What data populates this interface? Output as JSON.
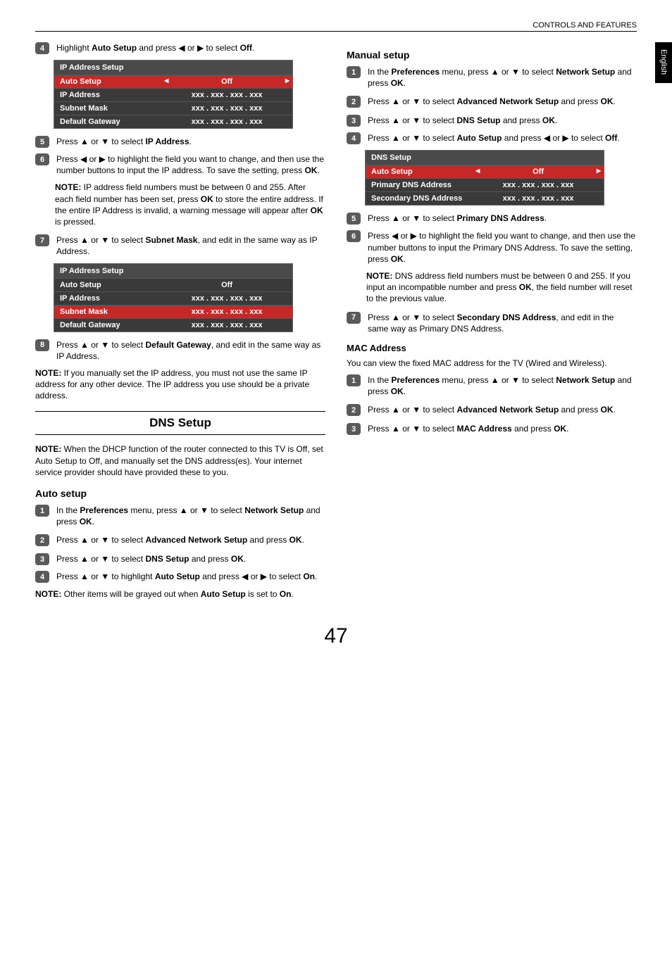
{
  "header": "CONTROLS AND FEATURES",
  "langTab": "English",
  "pageNumber": "47",
  "left": {
    "step4": {
      "pre": "Highlight ",
      "bold1": "Auto Setup",
      "mid": " and press ◀ or ▶ to select ",
      "bold2": "Off",
      "post": "."
    },
    "table1": {
      "title": "IP Address Setup",
      "rows": [
        {
          "label": "Auto Setup",
          "val": "Off",
          "sel": true,
          "arrows": true
        },
        {
          "label": "IP Address",
          "val": "xxx   .   xxx   .   xxx   .   xxx"
        },
        {
          "label": "Subnet Mask",
          "val": "xxx   .   xxx   .   xxx   .   xxx"
        },
        {
          "label": "Default Gateway",
          "val": "xxx   .   xxx   .   xxx   .   xxx"
        }
      ]
    },
    "step5": {
      "pre": "Press ▲ or ▼ to select ",
      "bold": "IP Address",
      "post": "."
    },
    "step6": {
      "pre": "Press ◀ or ▶ to highlight the field you want to change, and then use the number buttons to input the IP address. To save the setting, press ",
      "bold": "OK",
      "post": "."
    },
    "note1": {
      "label": "NOTE: ",
      "pre": "IP address field numbers must be between 0 and 255. After each field number has been set, press ",
      "b1": "OK",
      "mid": " to store the entire address. If the entire IP Address is invalid, a warning message will appear after ",
      "b2": "OK",
      "post": " is pressed."
    },
    "step7": {
      "pre": "Press ▲ or ▼ to select ",
      "bold": "Subnet Mask",
      "post": ", and edit in the same way as IP Address."
    },
    "table2": {
      "title": "IP Address Setup",
      "rows": [
        {
          "label": "Auto Setup",
          "val": "Off"
        },
        {
          "label": "IP Address",
          "val": "xxx   .   xxx   .   xxx   .   xxx"
        },
        {
          "label": "Subnet Mask",
          "val": "xxx   .   xxx   .   xxx   .   xxx",
          "sel": true
        },
        {
          "label": "Default Gateway",
          "val": "xxx   .   xxx   .   xxx   .   xxx"
        }
      ]
    },
    "step8": {
      "pre": "Press ▲ or ▼ to select ",
      "bold": "Default Gateway",
      "post": ", and edit in the same way as IP Address."
    },
    "note2": {
      "label": "NOTE: ",
      "text": "If you manually set the IP address, you must not use the same IP address for any other device. The IP address you use should be a private address."
    },
    "sectionTitle": "DNS Setup",
    "note3": {
      "label": "NOTE: ",
      "text": "When the DHCP function of the router connected to this TV is Off, set Auto Setup to Off, and manually set the DNS address(es). Your internet service provider should have provided these to you."
    },
    "autoSetupHeading": "Auto setup",
    "as_step1": {
      "pre": "In the ",
      "b1": "Preferences",
      "mid": " menu, press ▲ or ▼ to select ",
      "b2": "Network Setup",
      "mid2": " and press ",
      "b3": "OK",
      "post": "."
    },
    "as_step2": {
      "pre": "Press ▲ or ▼ to select ",
      "b1": "Advanced Network Setup",
      "mid": " and press ",
      "b2": "OK",
      "post": "."
    },
    "as_step3": {
      "pre": "Press ▲ or ▼ to select ",
      "b1": "DNS Setup",
      "mid": " and press ",
      "b2": "OK",
      "post": "."
    },
    "as_step4": {
      "pre": "Press ▲ or ▼ to highlight ",
      "b1": "Auto Setup",
      "mid": " and press ◀ or ▶ to select ",
      "b2": "On",
      "post": "."
    },
    "note4": {
      "label": "NOTE: ",
      "pre": "Other items will be grayed out when ",
      "b1": "Auto Setup",
      "mid": " is set to ",
      "b2": "On",
      "post": "."
    }
  },
  "right": {
    "manualHeading": "Manual setup",
    "ms_step1": {
      "pre": "In the ",
      "b1": "Preferences",
      "mid": " menu, press ▲ or ▼ to select ",
      "b2": "Network Setup",
      "mid2": " and press ",
      "b3": "OK",
      "post": "."
    },
    "ms_step2": {
      "pre": "Press ▲ or ▼ to select ",
      "b1": "Advanced Network Setup",
      "mid": " and press ",
      "b2": "OK",
      "post": "."
    },
    "ms_step3": {
      "pre": "Press ▲ or ▼ to select ",
      "b1": "DNS Setup",
      "mid": " and press ",
      "b2": "OK",
      "post": "."
    },
    "ms_step4": {
      "pre": "Press ▲ or ▼ to select ",
      "b1": "Auto Setup",
      "mid": " and press ◀ or ▶ to select ",
      "b2": "Off",
      "post": "."
    },
    "table": {
      "title": "DNS Setup",
      "rows": [
        {
          "label": "Auto Setup",
          "val": "Off",
          "sel": true,
          "arrows": true
        },
        {
          "label": "Primary DNS Address",
          "val": "xxx   .   xxx   .   xxx   .   xxx"
        },
        {
          "label": "Secondary DNS Address",
          "val": "xxx   .   xxx   .   xxx   .   xxx"
        }
      ]
    },
    "ms_step5": {
      "pre": "Press ▲ or ▼ to select ",
      "bold": "Primary DNS Address",
      "post": "."
    },
    "ms_step6": {
      "pre": "Press ◀ or ▶ to highlight the field you want to change, and then use the number buttons to input the Primary DNS Address. To save the setting, press ",
      "bold": "OK",
      "post": "."
    },
    "note1": {
      "label": "NOTE: ",
      "pre": "DNS address field numbers must be between 0 and 255. If you input an incompatible number and press ",
      "b1": "OK",
      "post": ", the field number will reset to the previous value."
    },
    "ms_step7": {
      "pre": "Press ▲ or ▼ to select ",
      "bold": "Secondary DNS Address",
      "post": ", and edit in the same way as Primary DNS Address."
    },
    "macHeading": "MAC Address",
    "macIntro": " You can view the fixed MAC address for the TV (Wired and Wireless).",
    "mac_step1": {
      "pre": "In the ",
      "b1": "Preferences",
      "mid": " menu, press ▲ or ▼ to select ",
      "b2": "Network Setup",
      "mid2": " and press ",
      "b3": "OK",
      "post": "."
    },
    "mac_step2": {
      "pre": "Press ▲ or ▼ to select ",
      "b1": "Advanced Network Setup",
      "mid": " and press ",
      "b2": "OK",
      "post": "."
    },
    "mac_step3": {
      "pre": "Press ▲ or ▼ to select ",
      "b1": "MAC Address",
      "mid": " and press ",
      "b2": "OK",
      "post": "."
    }
  }
}
